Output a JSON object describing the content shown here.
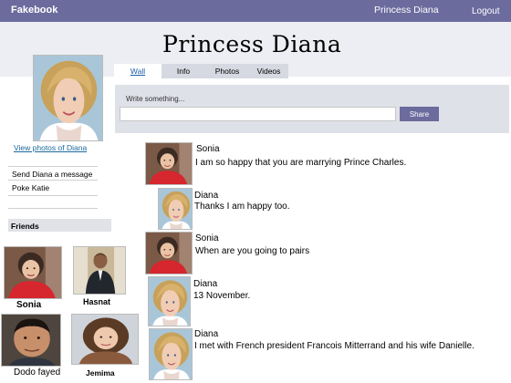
{
  "topbar": {
    "brand": "Fakebook",
    "user_name": "Princess Diana",
    "logout": "Logout"
  },
  "profile": {
    "title": "Princess Diana"
  },
  "tabs": [
    {
      "label": "Wall",
      "active": true
    },
    {
      "label": "Info",
      "active": false
    },
    {
      "label": "Photos",
      "active": false
    },
    {
      "label": "Videos",
      "active": false
    }
  ],
  "composer": {
    "label": "Write something...",
    "value": "",
    "share_label": "Share"
  },
  "sidebar": {
    "view_photos": "View photos of Diana",
    "actions": [
      "Send Diana a message",
      "Poke Katie"
    ],
    "friends_header": "Friends",
    "friends": [
      "Sonia",
      "Hasnat",
      "Dodo fayed",
      "Jemima"
    ]
  },
  "posts": [
    {
      "author": "Sonia",
      "text": "I am so happy that you are marrying Prince Charles."
    },
    {
      "author": "Diana",
      "text": "Thanks I am happy too."
    },
    {
      "author": "Sonia",
      "text": "When are you going to pairs"
    },
    {
      "author": "Diana",
      "text": "13 November."
    },
    {
      "author": "Diana",
      "text": "I met with French president Francois Mitterrand and his wife Danielle."
    }
  ],
  "colors": {
    "topbar": "#6b6b9e",
    "band": "#eceef3",
    "link": "#1c6a9e",
    "panel": "#dfe1e8"
  }
}
